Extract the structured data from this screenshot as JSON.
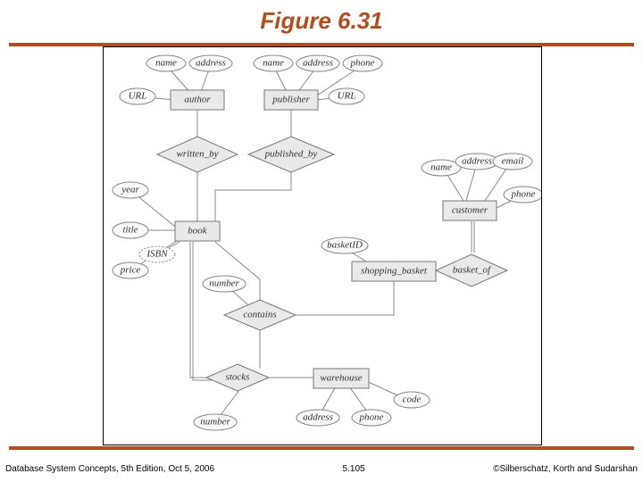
{
  "title": "Figure 6.31",
  "footer": {
    "left": "Database System Concepts, 5th Edition, Oct 5, 2006",
    "center": "5.105",
    "right": "©Silberschatz, Korth and Sudarshan"
  },
  "entities": {
    "author": "author",
    "publisher": "publisher",
    "customer": "customer",
    "book": "book",
    "shopping_basket": "shopping_basket",
    "warehouse": "warehouse",
    "stocks": "stocks"
  },
  "relationships": {
    "written_by": "written_by",
    "published_by": "published_by",
    "contains": "contains",
    "basket_of": "basket_of"
  },
  "attrs": {
    "author_name": "name",
    "author_address": "address",
    "author_url": "URL",
    "pub_name": "name",
    "pub_address": "address",
    "pub_phone": "phone",
    "pub_url": "URL",
    "cust_name": "name",
    "cust_address": "address",
    "cust_email": "email",
    "cust_phone": "phone",
    "book_year": "year",
    "book_title": "title",
    "book_price": "price",
    "book_isbn": "ISBN",
    "basket_id": "basketID",
    "contains_number": "number",
    "stocks_number": "number",
    "wh_address": "address",
    "wh_phone": "phone",
    "wh_code": "code"
  }
}
